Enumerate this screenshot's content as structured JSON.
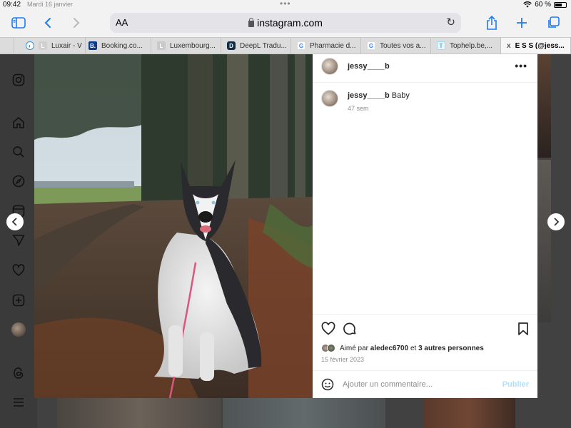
{
  "status_bar": {
    "time": "09:42",
    "date": "Mardi 16 janvier",
    "battery": "60 %"
  },
  "browser": {
    "address": {
      "text_size_label": "AA",
      "url": "instagram.com"
    },
    "tabs": [
      {
        "label": "Luxair - V",
        "favicon": "L"
      },
      {
        "label": "Booking.co...",
        "favicon": "B."
      },
      {
        "label": "Luxembourg...",
        "favicon": "L"
      },
      {
        "label": "DeepL Tradu...",
        "favicon": "D"
      },
      {
        "label": "Pharmacie d...",
        "favicon": "G"
      },
      {
        "label": "Toutes vos a...",
        "favicon": "G"
      },
      {
        "label": "Tophelp.be,...",
        "favicon": "T"
      },
      {
        "label": "E S S (@jess...",
        "favicon": "x"
      }
    ]
  },
  "post": {
    "username": "jessy____b",
    "caption_user": "jessy____b",
    "caption_text": "Baby",
    "caption_time": "47 sem",
    "likes": {
      "prefix": "Aimé par",
      "user": "aledec6700",
      "middle": "et",
      "others": "3 autres personnes"
    },
    "date": "15 février 2023",
    "comment_placeholder": "Ajouter un commentaire...",
    "publish_label": "Publier"
  },
  "colors": {
    "accent": "#1e7bf2",
    "publish_disabled": "#b2dffc",
    "muted": "#8e8e8e"
  }
}
